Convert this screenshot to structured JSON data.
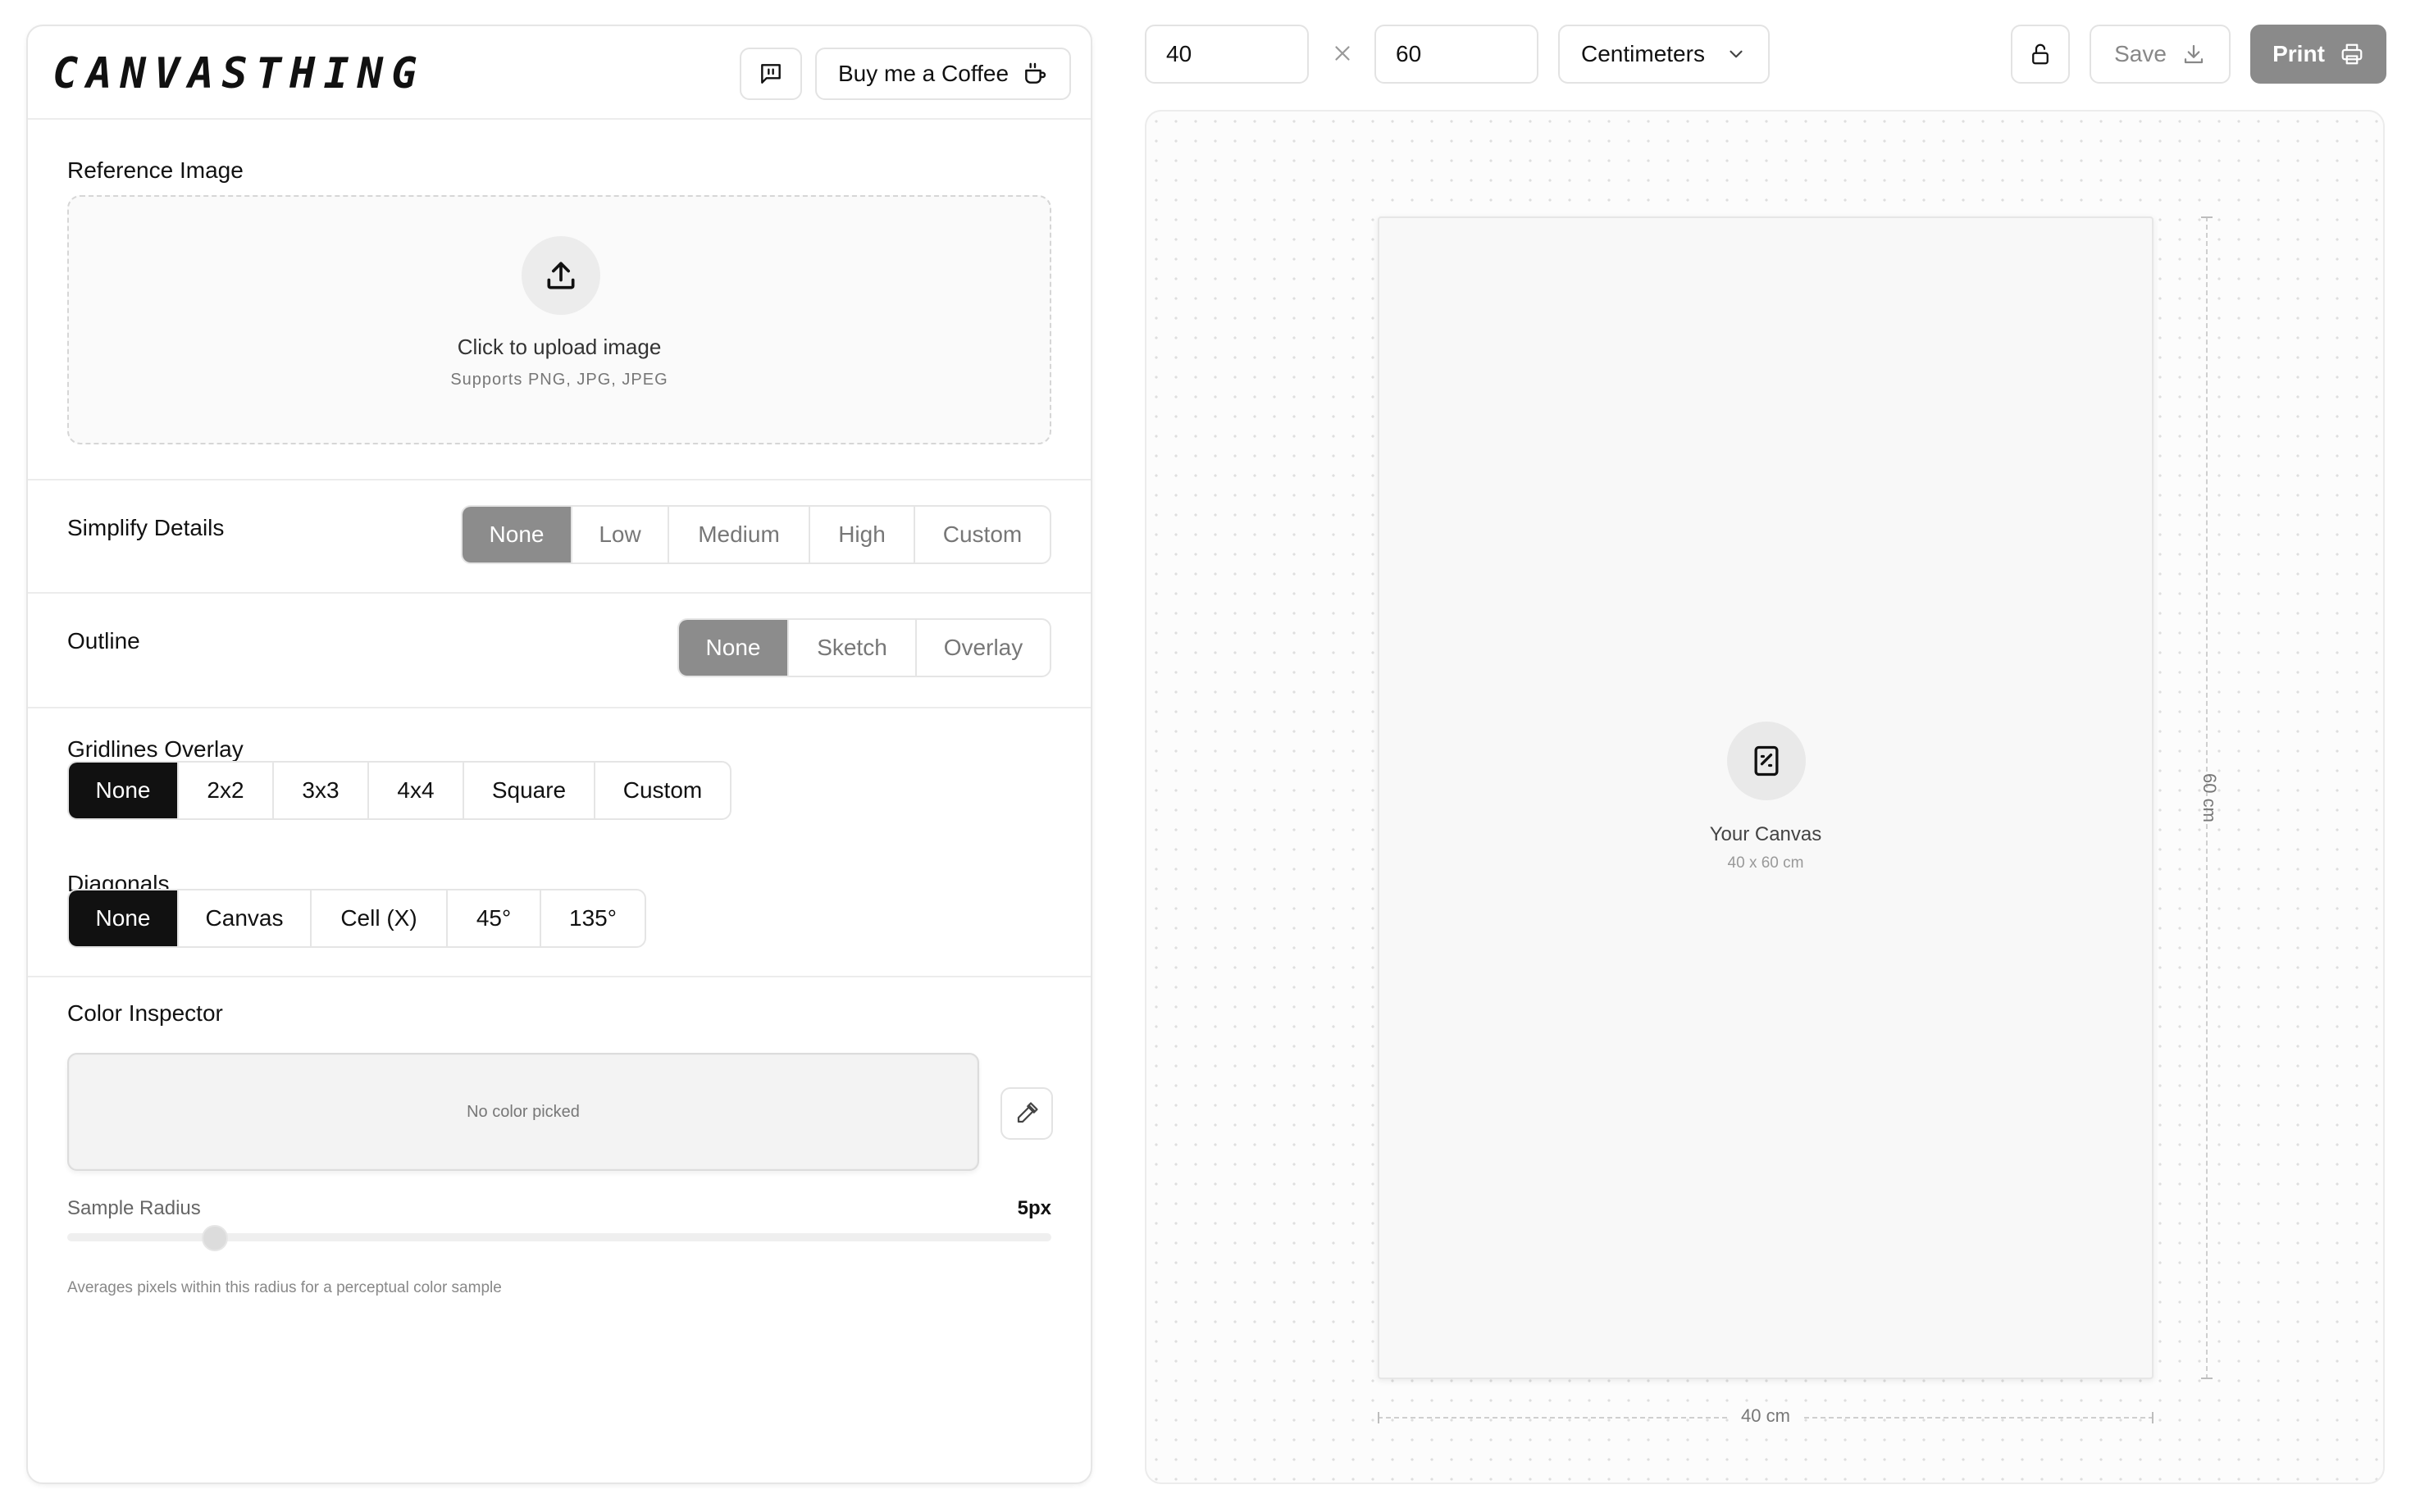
{
  "app": {
    "logo": "CANVASTHING",
    "coffee_label": "Buy me a Coffee"
  },
  "reference": {
    "label": "Reference Image",
    "upload_title": "Click to upload image",
    "upload_sub": "Supports PNG, JPG, JPEG"
  },
  "simplify": {
    "label": "Simplify Details",
    "options": [
      "None",
      "Low",
      "Medium",
      "High",
      "Custom"
    ],
    "selected": "None"
  },
  "outline": {
    "label": "Outline",
    "options": [
      "None",
      "Sketch",
      "Overlay"
    ],
    "selected": "None"
  },
  "gridlines": {
    "label": "Gridlines Overlay",
    "options": [
      "None",
      "2x2",
      "3x3",
      "4x4",
      "Square",
      "Custom"
    ],
    "selected": "None"
  },
  "diagonals": {
    "label": "Diagonals",
    "options": [
      "None",
      "Canvas",
      "Cell (X)",
      "45°",
      "135°"
    ],
    "selected": "None"
  },
  "color_inspector": {
    "label": "Color Inspector",
    "empty_text": "No color picked",
    "sample_radius_label": "Sample Radius",
    "sample_radius_value": "5px",
    "sample_radius_level": 0.15,
    "hint": "Averages pixels within this radius for a perceptual color sample"
  },
  "toolbar": {
    "width_value": "40",
    "height_value": "60",
    "unit": "Centimeters",
    "save_label": "Save",
    "print_label": "Print"
  },
  "canvas": {
    "title": "Your Canvas",
    "size_text": "40 x 60 cm",
    "width_label": "40 cm",
    "height_label": "60 cm"
  },
  "colors": {
    "accent_dark": "#111111",
    "muted_selected": "#8c8c8c",
    "print_bg": "#8a8a8a"
  }
}
